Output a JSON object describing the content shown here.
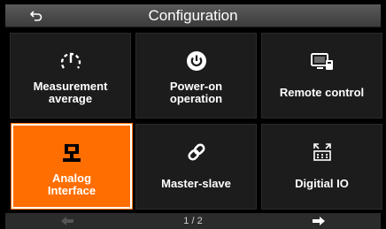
{
  "header": {
    "title": "Configuration",
    "back_icon": "back-arrow-icon"
  },
  "tiles": [
    {
      "label": "Measurement\naverage",
      "icon": "gauge-icon",
      "active": false
    },
    {
      "label": "Power-on\noperation",
      "icon": "power-icon",
      "active": false
    },
    {
      "label": "Remote control",
      "icon": "remote-monitor-icon",
      "active": false
    },
    {
      "label": "Analog\nInterface",
      "icon": "analog-interface-icon",
      "active": true
    },
    {
      "label": "Master-slave",
      "icon": "link-icon",
      "active": false
    },
    {
      "label": "Digitial IO",
      "icon": "digital-io-icon",
      "active": false
    }
  ],
  "footer": {
    "page": "1 / 2",
    "prev_icon": "left-arrow-icon",
    "next_icon": "right-arrow-icon"
  },
  "colors": {
    "active_tile": "#ff6e00",
    "tile": "#1c1c1c",
    "header": "#4a4a4a",
    "disabled_arrow": "#555555",
    "enabled_arrow": "#ffffff"
  }
}
